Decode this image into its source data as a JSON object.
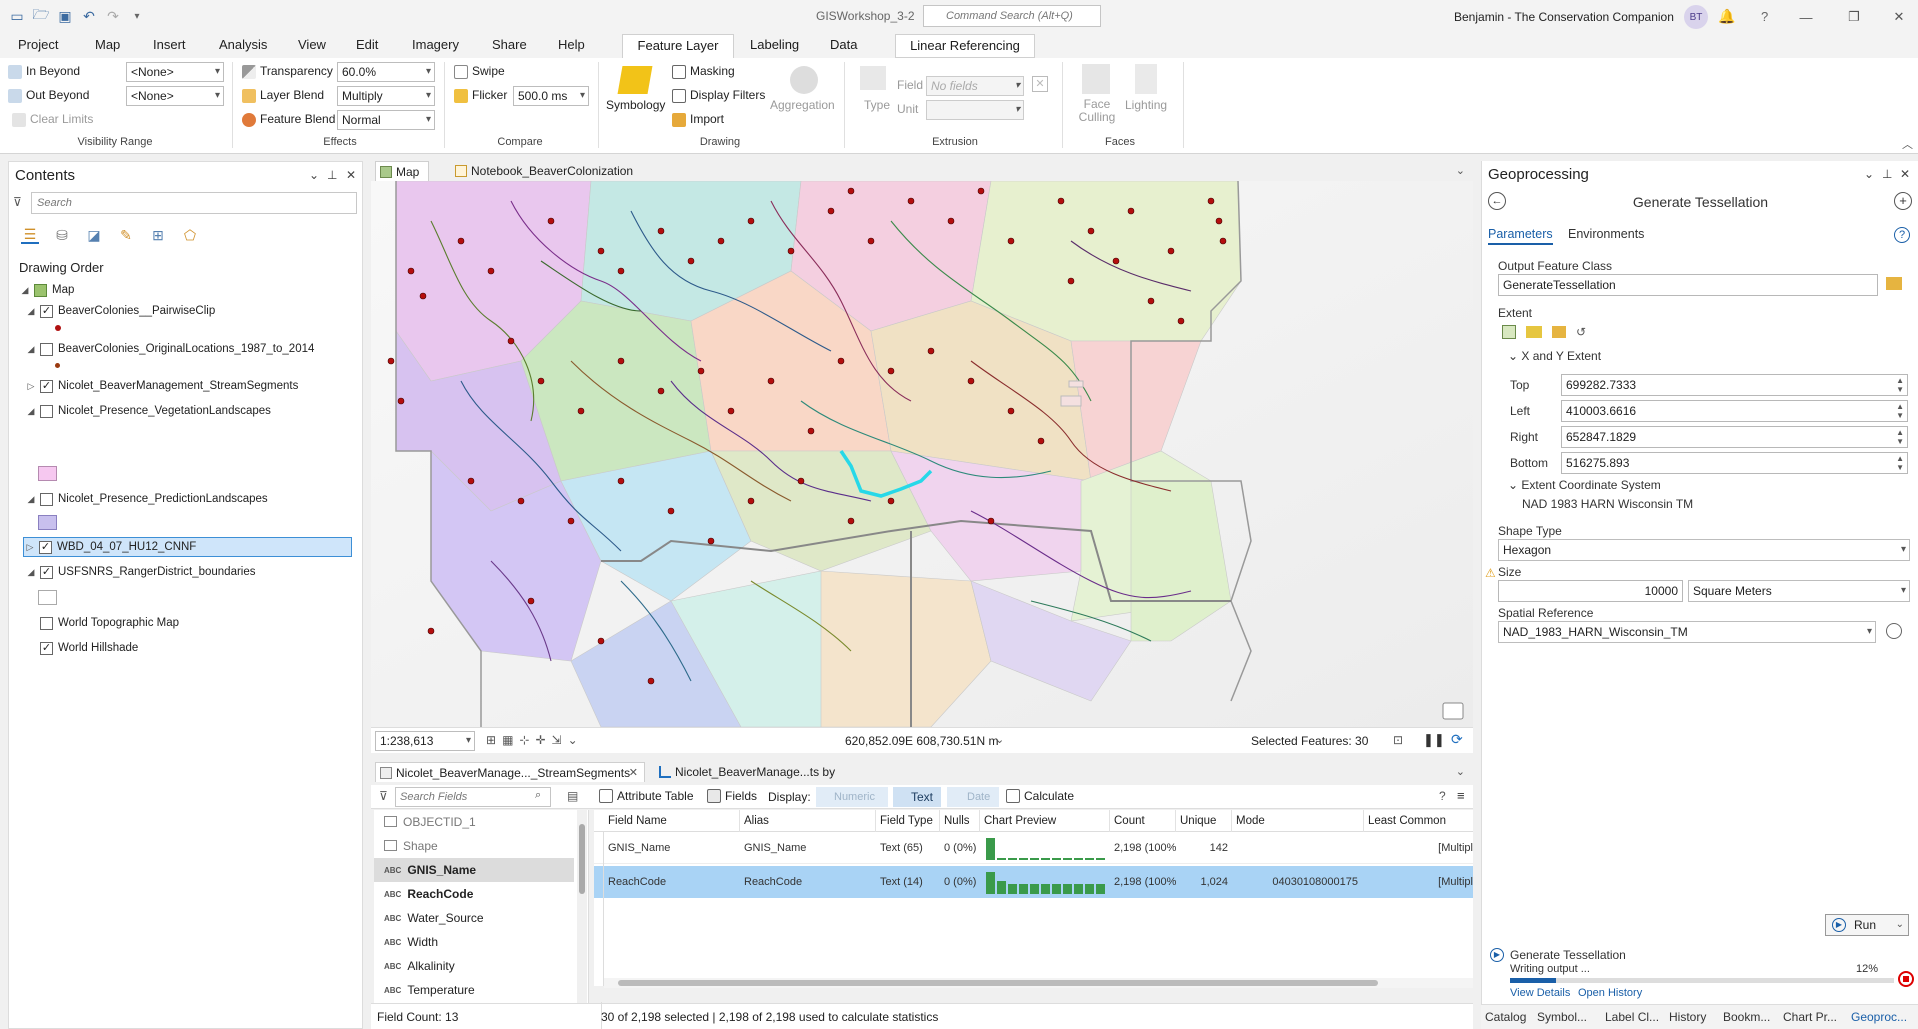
{
  "app": {
    "title": "GISWorkshop_3-2",
    "command_search_placeholder": "Command Search (Alt+Q)",
    "user": "Benjamin - The Conservation Companion",
    "avatar_initials": "BT"
  },
  "ribbon_tabs": [
    "Project",
    "Map",
    "Insert",
    "Analysis",
    "View",
    "Edit",
    "Imagery",
    "Share",
    "Help",
    "Feature Layer",
    "Labeling",
    "Data",
    "Linear Referencing"
  ],
  "ribbon": {
    "visibility": {
      "in_beyond": "In Beyond",
      "out_beyond": "Out Beyond",
      "clear_limits": "Clear Limits",
      "in_value": "<None>",
      "out_value": "<None>",
      "title": "Visibility Range"
    },
    "effects": {
      "transparency_label": "Transparency",
      "transparency_value": "60.0%",
      "layer_blend_label": "Layer Blend",
      "layer_blend_value": "Multiply",
      "feature_blend_label": "Feature Blend",
      "feature_blend_value": "Normal",
      "title": "Effects"
    },
    "compare": {
      "swipe": "Swipe",
      "flicker": "Flicker",
      "flicker_value": "500.0 ms",
      "title": "Compare"
    },
    "drawing": {
      "symbology": "Symbology",
      "masking": "Masking",
      "display_filters": "Display Filters",
      "import": "Import",
      "aggregation": "Aggregation",
      "title": "Drawing"
    },
    "extrusion": {
      "type": "Type",
      "field_label": "Field",
      "field_value": "No fields",
      "unit_label": "Unit",
      "title": "Extrusion"
    },
    "faces": {
      "face_culling": "Face Culling",
      "lighting": "Lighting",
      "title": "Faces"
    }
  },
  "contents": {
    "title": "Contents",
    "search_placeholder": "Search",
    "drawing_order": "Drawing Order",
    "map_label": "Map",
    "layers": [
      {
        "name": "BeaverColonies__PairwiseClip",
        "checked": true
      },
      {
        "name": "BeaverColonies_OriginalLocations_1987_to_2014",
        "checked": false
      },
      {
        "name": "Nicolet_BeaverManagement_StreamSegments",
        "checked": true
      },
      {
        "name": "Nicolet_Presence_VegetationLandscapes",
        "checked": false
      },
      {
        "name": "Nicolet_Presence_PredictionLandscapes",
        "checked": false
      },
      {
        "name": "WBD_04_07_HU12_CNNF",
        "checked": true
      },
      {
        "name": "USFSNRS_RangerDistrict_boundaries",
        "checked": true
      },
      {
        "name": "World Topographic Map",
        "checked": false
      },
      {
        "name": "World Hillshade",
        "checked": true
      }
    ]
  },
  "map_tabs": {
    "map": "Map",
    "notebook": "Notebook_BeaverColonization"
  },
  "map_status": {
    "scale": "1:238,613",
    "coords": "620,852.09E 608,730.51N m",
    "selected": "Selected Features: 30"
  },
  "fields_view": {
    "tab1": "Nicolet_BeaverManage..._StreamSegments",
    "tab2": "Nicolet_BeaverManage...ts by ReachCode",
    "search_placeholder": "Search Fields",
    "attribute_table": "Attribute Table",
    "fields": "Fields",
    "display": "Display:",
    "numeric": "Numeric",
    "text": "Text",
    "date": "Date",
    "calculate": "Calculate",
    "field_list": [
      "OBJECTID_1",
      "Shape",
      "GNIS_Name",
      "ReachCode",
      "Water_Source",
      "Width",
      "Alkalinity",
      "Temperature"
    ],
    "field_count": "Field Count: 13",
    "headers": [
      "Field Name",
      "Alias",
      "Field Type",
      "Nulls",
      "Chart Preview",
      "Count",
      "Unique",
      "Mode",
      "Least Common"
    ],
    "rows": [
      {
        "name": "GNIS_Name",
        "alias": "GNIS_Name",
        "type": "Text (65)",
        "nulls": "0 (0%)",
        "count": "2,198 (100%)",
        "unique": "142",
        "mode": "",
        "least": "[Multipl",
        "bars": [
          1.0,
          0.05,
          0.05,
          0.05,
          0.05,
          0.05,
          0.05,
          0.05,
          0.05,
          0.05,
          0.05
        ]
      },
      {
        "name": "ReachCode",
        "alias": "ReachCode",
        "type": "Text (14)",
        "nulls": "0 (0%)",
        "count": "2,198 (100%)",
        "unique": "1,024",
        "mode": "04030108000175",
        "least": "[Multipl",
        "bars": [
          1.0,
          0.6,
          0.45,
          0.45,
          0.45,
          0.45,
          0.45,
          0.45,
          0.45,
          0.45,
          0.45
        ]
      }
    ],
    "status": "30 of 2,198 selected | 2,198 of 2,198 used to calculate statistics"
  },
  "geoprocessing": {
    "title": "Geoprocessing",
    "tool": "Generate Tessellation",
    "tab_parameters": "Parameters",
    "tab_environments": "Environments",
    "output_label": "Output Feature Class",
    "output_value": "GenerateTessellation",
    "extent_label": "Extent",
    "xy_extent": "X and Y Extent",
    "top_label": "Top",
    "top": "699282.7333",
    "left_label": "Left",
    "left": "410003.6616",
    "right_label": "Right",
    "right": "652847.1829",
    "bottom_label": "Bottom",
    "bottom": "516275.893",
    "extent_cs_label": "Extent Coordinate System",
    "extent_cs": "NAD 1983 HARN Wisconsin TM",
    "shape_type_label": "Shape Type",
    "shape_type": "Hexagon",
    "size_label": "Size",
    "size_value": "10000",
    "size_unit": "Square Meters",
    "spatial_ref_label": "Spatial Reference",
    "spatial_ref": "NAD_1983_HARN_Wisconsin_TM",
    "run": "Run",
    "progress_tool": "Generate Tessellation",
    "progress_msg": "Writing output ...",
    "progress_pct": "12%",
    "progress_fraction": 0.12,
    "view_details": "View Details",
    "open_history": "Open History"
  },
  "bottom_tabs": [
    "Catalog",
    "Symbol...",
    "Label Cl...",
    "History",
    "Bookm...",
    "Chart Pr...",
    "Geoproc..."
  ]
}
